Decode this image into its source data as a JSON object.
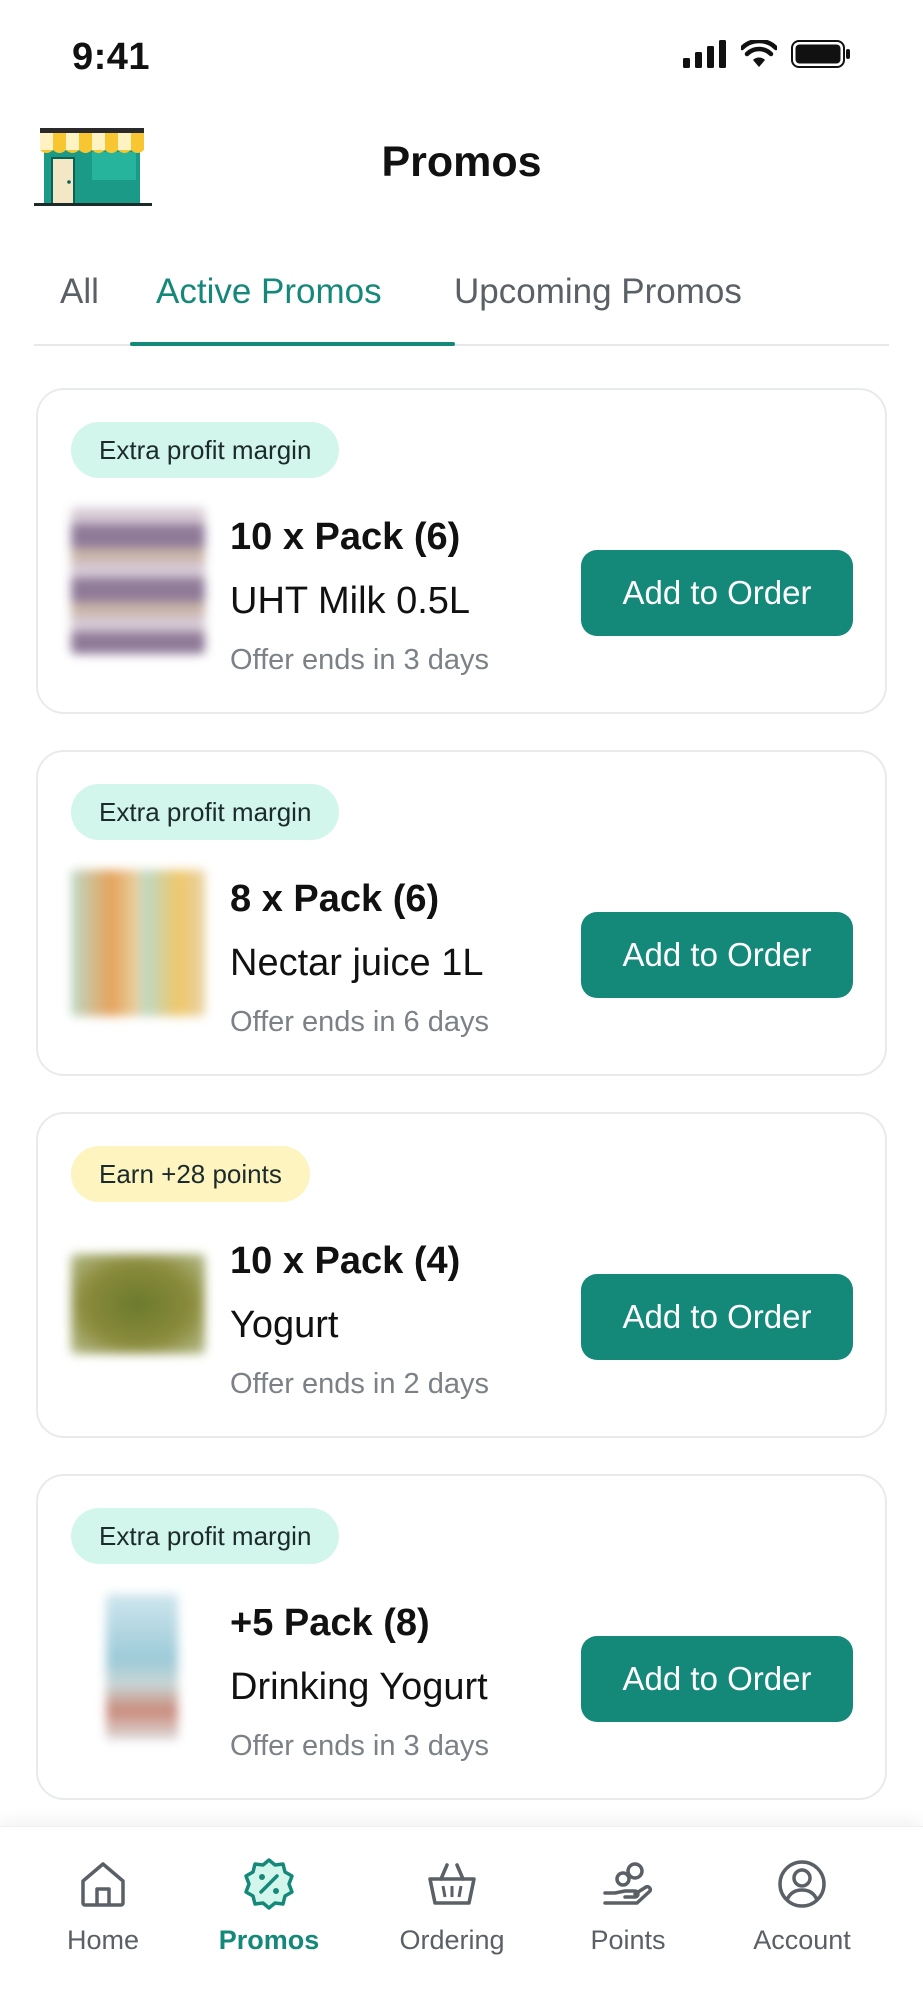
{
  "status_bar": {
    "time": "9:41"
  },
  "header": {
    "title": "Promos"
  },
  "tabs": [
    {
      "label": "All",
      "active": false
    },
    {
      "label": "Active Promos",
      "active": true
    },
    {
      "label": "Upcoming Promos",
      "active": false
    }
  ],
  "promos": [
    {
      "badge": "Extra profit margin",
      "badge_type": "green",
      "quantity": "10 x Pack (6)",
      "product": "UHT Milk 0.5L",
      "offer": "Offer ends in 3 days",
      "button": "Add to Order"
    },
    {
      "badge": "Extra profit margin",
      "badge_type": "green",
      "quantity": "8 x Pack (6)",
      "product": "Nectar juice 1L",
      "offer": "Offer ends in 6 days",
      "button": "Add to Order"
    },
    {
      "badge": "Earn +28 points",
      "badge_type": "yellow",
      "quantity": "10 x Pack (4)",
      "product": "Yogurt",
      "offer": "Offer ends in 2 days",
      "button": "Add to Order"
    },
    {
      "badge": "Extra profit margin",
      "badge_type": "green",
      "quantity": "+5 Pack (8)",
      "product": "Drinking Yogurt",
      "offer": "Offer ends in 3 days",
      "button": "Add to Order"
    }
  ],
  "bottom_nav": [
    {
      "label": "Home",
      "icon": "home-icon",
      "active": false
    },
    {
      "label": "Promos",
      "icon": "promo-icon",
      "active": true
    },
    {
      "label": "Ordering",
      "icon": "basket-icon",
      "active": false
    },
    {
      "label": "Points",
      "icon": "points-icon",
      "active": false
    },
    {
      "label": "Account",
      "icon": "account-icon",
      "active": false
    }
  ],
  "colors": {
    "accent": "#14897a",
    "badge_green": "#d3f6ec",
    "badge_yellow": "#fdf4bf",
    "muted_text": "#7b8186"
  }
}
